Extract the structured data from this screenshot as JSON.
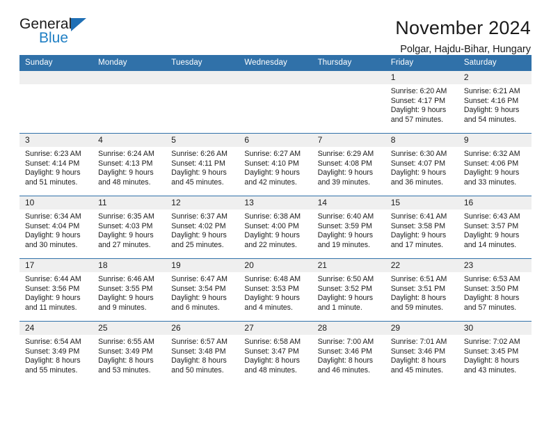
{
  "brand": {
    "name_part1": "General",
    "name_part2": "Blue",
    "triangle_color": "#1f6fb5",
    "blue_color": "#1f7fc4"
  },
  "header": {
    "title": "November 2024",
    "subtitle": "Polgar, Hajdu-Bihar, Hungary"
  },
  "theme": {
    "header_blue": "#3071a9",
    "daynum_gray": "#efefef",
    "text": "#1a1a1a"
  },
  "weekdays": [
    "Sunday",
    "Monday",
    "Tuesday",
    "Wednesday",
    "Thursday",
    "Friday",
    "Saturday"
  ],
  "labels": {
    "sunrise_prefix": "Sunrise:",
    "sunset_prefix": "Sunset:",
    "daylight_prefix": "Daylight:"
  },
  "weeks": [
    [
      {
        "day": "",
        "blank": true
      },
      {
        "day": "",
        "blank": true
      },
      {
        "day": "",
        "blank": true
      },
      {
        "day": "",
        "blank": true
      },
      {
        "day": "",
        "blank": true
      },
      {
        "day": "1",
        "sunrise": "Sunrise: 6:20 AM",
        "sunset": "Sunset: 4:17 PM",
        "daylight": "Daylight: 9 hours and 57 minutes."
      },
      {
        "day": "2",
        "sunrise": "Sunrise: 6:21 AM",
        "sunset": "Sunset: 4:16 PM",
        "daylight": "Daylight: 9 hours and 54 minutes."
      }
    ],
    [
      {
        "day": "3",
        "sunrise": "Sunrise: 6:23 AM",
        "sunset": "Sunset: 4:14 PM",
        "daylight": "Daylight: 9 hours and 51 minutes."
      },
      {
        "day": "4",
        "sunrise": "Sunrise: 6:24 AM",
        "sunset": "Sunset: 4:13 PM",
        "daylight": "Daylight: 9 hours and 48 minutes."
      },
      {
        "day": "5",
        "sunrise": "Sunrise: 6:26 AM",
        "sunset": "Sunset: 4:11 PM",
        "daylight": "Daylight: 9 hours and 45 minutes."
      },
      {
        "day": "6",
        "sunrise": "Sunrise: 6:27 AM",
        "sunset": "Sunset: 4:10 PM",
        "daylight": "Daylight: 9 hours and 42 minutes."
      },
      {
        "day": "7",
        "sunrise": "Sunrise: 6:29 AM",
        "sunset": "Sunset: 4:08 PM",
        "daylight": "Daylight: 9 hours and 39 minutes."
      },
      {
        "day": "8",
        "sunrise": "Sunrise: 6:30 AM",
        "sunset": "Sunset: 4:07 PM",
        "daylight": "Daylight: 9 hours and 36 minutes."
      },
      {
        "day": "9",
        "sunrise": "Sunrise: 6:32 AM",
        "sunset": "Sunset: 4:06 PM",
        "daylight": "Daylight: 9 hours and 33 minutes."
      }
    ],
    [
      {
        "day": "10",
        "sunrise": "Sunrise: 6:34 AM",
        "sunset": "Sunset: 4:04 PM",
        "daylight": "Daylight: 9 hours and 30 minutes."
      },
      {
        "day": "11",
        "sunrise": "Sunrise: 6:35 AM",
        "sunset": "Sunset: 4:03 PM",
        "daylight": "Daylight: 9 hours and 27 minutes."
      },
      {
        "day": "12",
        "sunrise": "Sunrise: 6:37 AM",
        "sunset": "Sunset: 4:02 PM",
        "daylight": "Daylight: 9 hours and 25 minutes."
      },
      {
        "day": "13",
        "sunrise": "Sunrise: 6:38 AM",
        "sunset": "Sunset: 4:00 PM",
        "daylight": "Daylight: 9 hours and 22 minutes."
      },
      {
        "day": "14",
        "sunrise": "Sunrise: 6:40 AM",
        "sunset": "Sunset: 3:59 PM",
        "daylight": "Daylight: 9 hours and 19 minutes."
      },
      {
        "day": "15",
        "sunrise": "Sunrise: 6:41 AM",
        "sunset": "Sunset: 3:58 PM",
        "daylight": "Daylight: 9 hours and 17 minutes."
      },
      {
        "day": "16",
        "sunrise": "Sunrise: 6:43 AM",
        "sunset": "Sunset: 3:57 PM",
        "daylight": "Daylight: 9 hours and 14 minutes."
      }
    ],
    [
      {
        "day": "17",
        "sunrise": "Sunrise: 6:44 AM",
        "sunset": "Sunset: 3:56 PM",
        "daylight": "Daylight: 9 hours and 11 minutes."
      },
      {
        "day": "18",
        "sunrise": "Sunrise: 6:46 AM",
        "sunset": "Sunset: 3:55 PM",
        "daylight": "Daylight: 9 hours and 9 minutes."
      },
      {
        "day": "19",
        "sunrise": "Sunrise: 6:47 AM",
        "sunset": "Sunset: 3:54 PM",
        "daylight": "Daylight: 9 hours and 6 minutes."
      },
      {
        "day": "20",
        "sunrise": "Sunrise: 6:48 AM",
        "sunset": "Sunset: 3:53 PM",
        "daylight": "Daylight: 9 hours and 4 minutes."
      },
      {
        "day": "21",
        "sunrise": "Sunrise: 6:50 AM",
        "sunset": "Sunset: 3:52 PM",
        "daylight": "Daylight: 9 hours and 1 minute."
      },
      {
        "day": "22",
        "sunrise": "Sunrise: 6:51 AM",
        "sunset": "Sunset: 3:51 PM",
        "daylight": "Daylight: 8 hours and 59 minutes."
      },
      {
        "day": "23",
        "sunrise": "Sunrise: 6:53 AM",
        "sunset": "Sunset: 3:50 PM",
        "daylight": "Daylight: 8 hours and 57 minutes."
      }
    ],
    [
      {
        "day": "24",
        "sunrise": "Sunrise: 6:54 AM",
        "sunset": "Sunset: 3:49 PM",
        "daylight": "Daylight: 8 hours and 55 minutes."
      },
      {
        "day": "25",
        "sunrise": "Sunrise: 6:55 AM",
        "sunset": "Sunset: 3:49 PM",
        "daylight": "Daylight: 8 hours and 53 minutes."
      },
      {
        "day": "26",
        "sunrise": "Sunrise: 6:57 AM",
        "sunset": "Sunset: 3:48 PM",
        "daylight": "Daylight: 8 hours and 50 minutes."
      },
      {
        "day": "27",
        "sunrise": "Sunrise: 6:58 AM",
        "sunset": "Sunset: 3:47 PM",
        "daylight": "Daylight: 8 hours and 48 minutes."
      },
      {
        "day": "28",
        "sunrise": "Sunrise: 7:00 AM",
        "sunset": "Sunset: 3:46 PM",
        "daylight": "Daylight: 8 hours and 46 minutes."
      },
      {
        "day": "29",
        "sunrise": "Sunrise: 7:01 AM",
        "sunset": "Sunset: 3:46 PM",
        "daylight": "Daylight: 8 hours and 45 minutes."
      },
      {
        "day": "30",
        "sunrise": "Sunrise: 7:02 AM",
        "sunset": "Sunset: 3:45 PM",
        "daylight": "Daylight: 8 hours and 43 minutes."
      }
    ]
  ]
}
